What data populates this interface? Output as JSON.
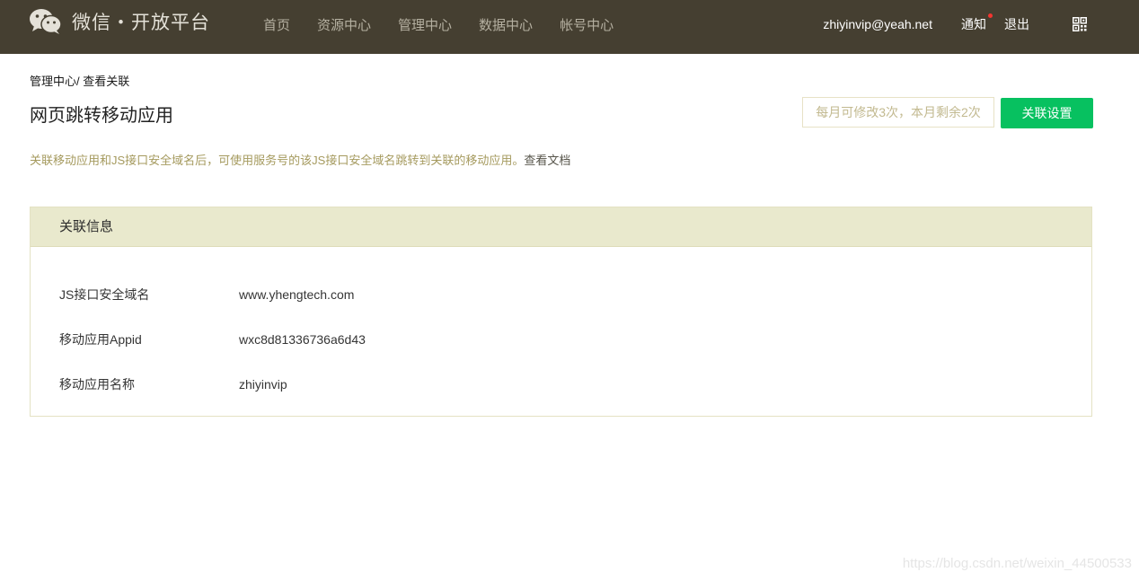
{
  "header": {
    "logo_text": "微信・开放平台",
    "nav": [
      "首页",
      "资源中心",
      "管理中心",
      "数据中心",
      "帐号中心"
    ],
    "user_email": "zhiyinvip@yeah.net",
    "notice_label": "通知",
    "logout_label": "退出",
    "icons": [
      "wechat-logo-icon",
      "qrcode-icon"
    ],
    "colors": {
      "bar": "#453f31",
      "notice_dot": "#f43530"
    }
  },
  "breadcrumb": {
    "parent": "管理中心",
    "separator": "/ ",
    "current": "查看关联"
  },
  "page": {
    "title": "网页跳转移动应用",
    "quota_text": "每月可修改3次，本月剩余2次",
    "button_label": "关联设置",
    "description": "关联移动应用和JS接口安全域名后，可使用服务号的该JS接口安全域名跳转到关联的移动应用。",
    "doc_link": "查看文档",
    "accent_color": "#07c160"
  },
  "panel": {
    "title": "关联信息",
    "rows": [
      {
        "label": "JS接口安全域名",
        "value": "www.yhengtech.com"
      },
      {
        "label": "移动应用Appid",
        "value": "wxc8d81336736a6d43"
      },
      {
        "label": "移动应用名称",
        "value": "zhiyinvip"
      }
    ]
  },
  "watermark": "https://blog.csdn.net/weixin_44500533"
}
